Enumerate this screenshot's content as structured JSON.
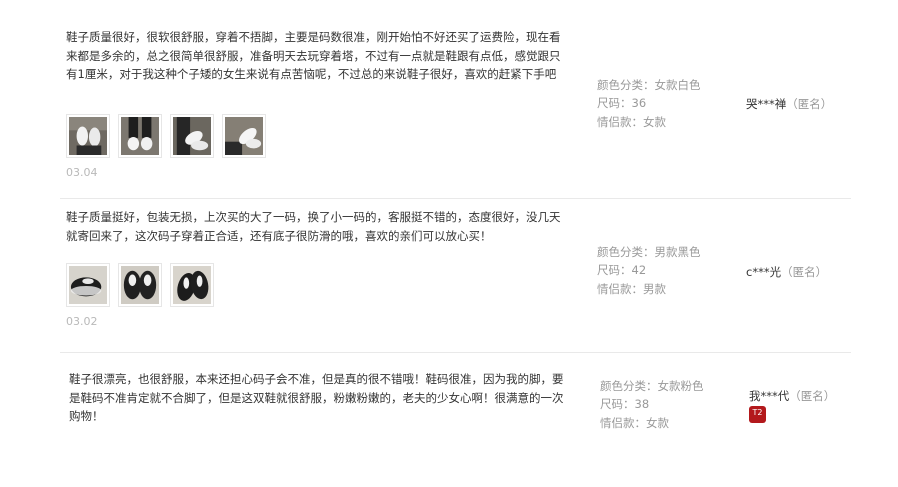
{
  "reviews": [
    {
      "content": "鞋子质量很好，很软很舒服，穿着不捂脚，主要是码数很准，刚开始怕不好还买了运费险，现在看来都是多余的，总之很简单很舒服，准备明天去玩穿着塔，不过有一点就是鞋跟有点低，感觉跟只有1厘米，对于我这种个子矮的女生来说有点苦恼呢，不过总的来说鞋子很好，喜欢的赶紧下手吧",
      "photos": [
        "white-sneakers-photo-1",
        "white-sneakers-photo-2",
        "white-sneakers-photo-3",
        "white-sneakers-photo-4"
      ],
      "date": "03.04",
      "color_label": "颜色分类：",
      "color_value": "女款白色",
      "size_label": "尺码：",
      "size_value": "36",
      "couple_label": "情侣款：",
      "couple_value": "女款",
      "user": "哭***禅",
      "anon": "（匿名）"
    },
    {
      "content": "鞋子质量挺好，包装无损，上次买的大了一码，换了小一码的，客服挺不错的，态度很好，没几天就寄回来了，这次码子穿着正合适，还有底子很防滑的哦，喜欢的亲们可以放心买！",
      "photos": [
        "black-sneakers-photo-1",
        "black-sneakers-photo-2",
        "black-sneakers-photo-3"
      ],
      "date": "03.02",
      "color_label": "颜色分类：",
      "color_value": "男款黑色",
      "size_label": "尺码：",
      "size_value": "42",
      "couple_label": "情侣款：",
      "couple_value": "男款",
      "user": "c***光",
      "anon": "（匿名）"
    },
    {
      "content": "鞋子很漂亮，也很舒服，本来还担心码子会不准，但是真的很不错哦！鞋码很准，因为我的脚，要是鞋码不准肯定就不合脚了，但是这双鞋就很舒服，粉嫩粉嫩的，老夫的少女心啊！很满意的一次购物！",
      "color_label": "颜色分类：",
      "color_value": "女款粉色",
      "size_label": "尺码：",
      "size_value": "38",
      "couple_label": "情侣款：",
      "couple_value": "女款",
      "user": "我***代",
      "anon": "（匿名）",
      "badge": "T2"
    }
  ],
  "colors": {
    "text": "#333333",
    "muted": "#999999",
    "date": "#b9b9b9",
    "divider": "#e9e9e9",
    "badge": "#b3191c"
  }
}
